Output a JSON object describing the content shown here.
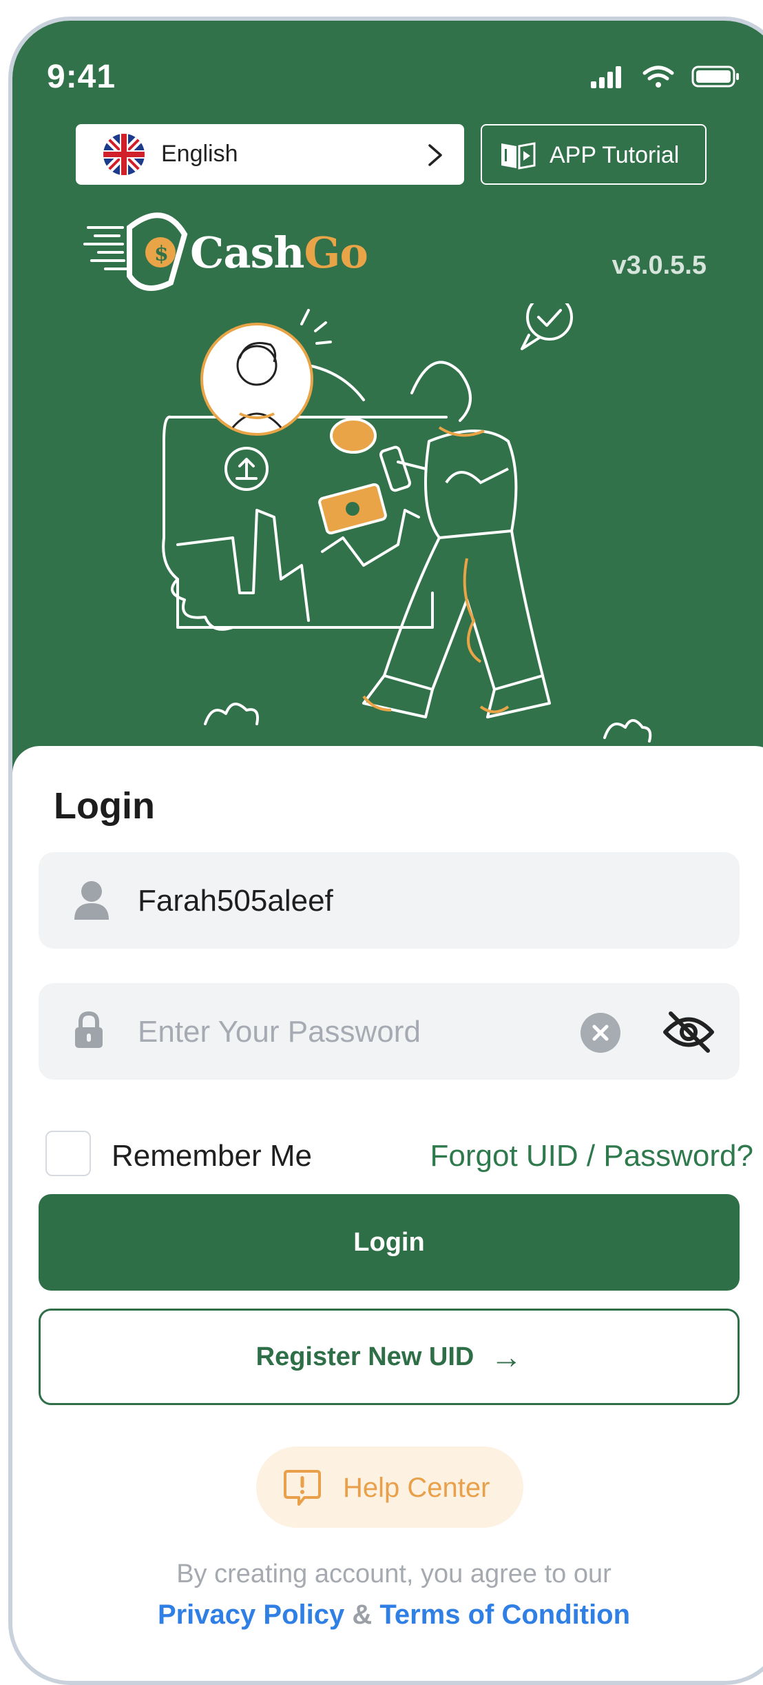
{
  "status_bar": {
    "time": "9:41"
  },
  "language": {
    "label": "English"
  },
  "tutorial": {
    "label": "APP Tutorial"
  },
  "brand": {
    "name_part1": "Cash",
    "name_part2": "Go",
    "version": "v3.0.5.5"
  },
  "login": {
    "title": "Login",
    "username_value": "Farah505aleef",
    "password_placeholder": "Enter Your Password",
    "remember_label": "Remember Me",
    "forgot_label": "Forgot UID / Password?",
    "login_button": "Login",
    "register_button": "Register New UID",
    "register_arrow": "→"
  },
  "help": {
    "label": "Help Center"
  },
  "terms": {
    "line1": "By creating account, you agree to our",
    "privacy": "Privacy Policy",
    "amp": "&",
    "terms": "Terms of Condition"
  },
  "colors": {
    "primary": "#2f6f48",
    "hero_bg": "#32724b",
    "accent": "#e9a04a",
    "link": "#2f7fe5"
  }
}
